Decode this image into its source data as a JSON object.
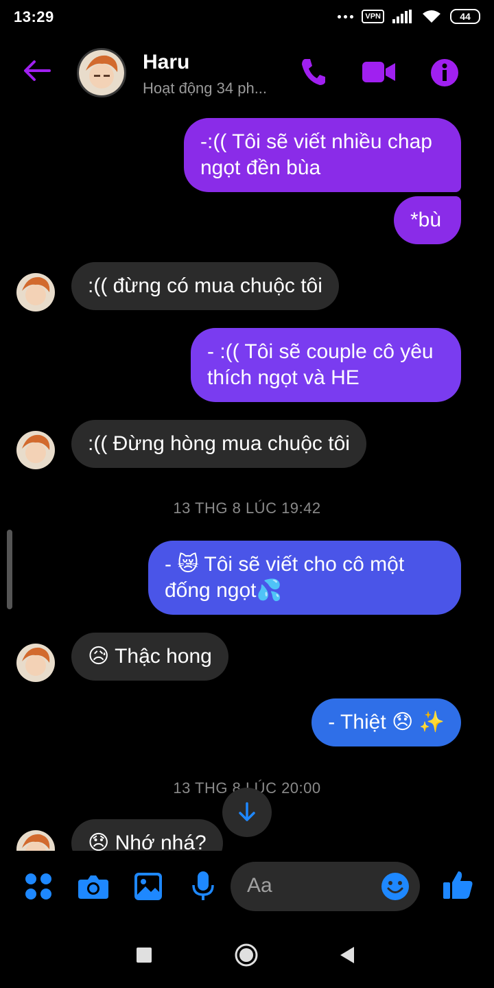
{
  "status": {
    "time": "13:29",
    "vpn": "VPN",
    "battery": "44"
  },
  "header": {
    "name": "Haru",
    "presence": "Hoạt động 34 ph...",
    "icons": [
      "back-arrow-icon",
      "phone-icon",
      "video-call-icon",
      "info-icon"
    ],
    "accent": "#a020f0"
  },
  "messages": [
    {
      "side": "out",
      "text": "-:(( Tôi sẽ viết nhiều chap ngọt đền bùa",
      "color": "#8a2ce8"
    },
    {
      "side": "out",
      "text": "*bù",
      "color": "#8a2ce8"
    },
    {
      "side": "in",
      "text": ":(( đừng có mua chuộc tôi"
    },
    {
      "side": "out",
      "text": "- :(( Tôi sẽ couple cô yêu thích ngọt và HE",
      "color": "#7a3cf0"
    },
    {
      "side": "in",
      "text": ":(( Đừng hòng mua chuộc tôi"
    },
    {
      "side": "timestamp",
      "text": "13 THG 8 LÚC 19:42"
    },
    {
      "side": "out",
      "text": "- 😿 Tôi sẽ viết cho cô một đống ngọt💦",
      "color": "#4a55e8"
    },
    {
      "side": "in",
      "text": "😥 Thậc hong"
    },
    {
      "side": "out",
      "text": "- Thiệt 😞 ✨",
      "color": "#2f6fe8"
    },
    {
      "side": "timestamp",
      "text": "13 THG 8 LÚC 20:00"
    },
    {
      "side": "in",
      "text": "😞 Nhớ nhá?"
    }
  ],
  "composer": {
    "placeholder": "Aa",
    "icons": [
      "apps-icon",
      "camera-icon",
      "gallery-icon",
      "microphone-icon",
      "emoji-icon",
      "like-icon"
    ],
    "color": "#1e88ff"
  },
  "navbar": {
    "icons": [
      "recents-square-icon",
      "home-circle-icon",
      "back-triangle-icon"
    ]
  }
}
